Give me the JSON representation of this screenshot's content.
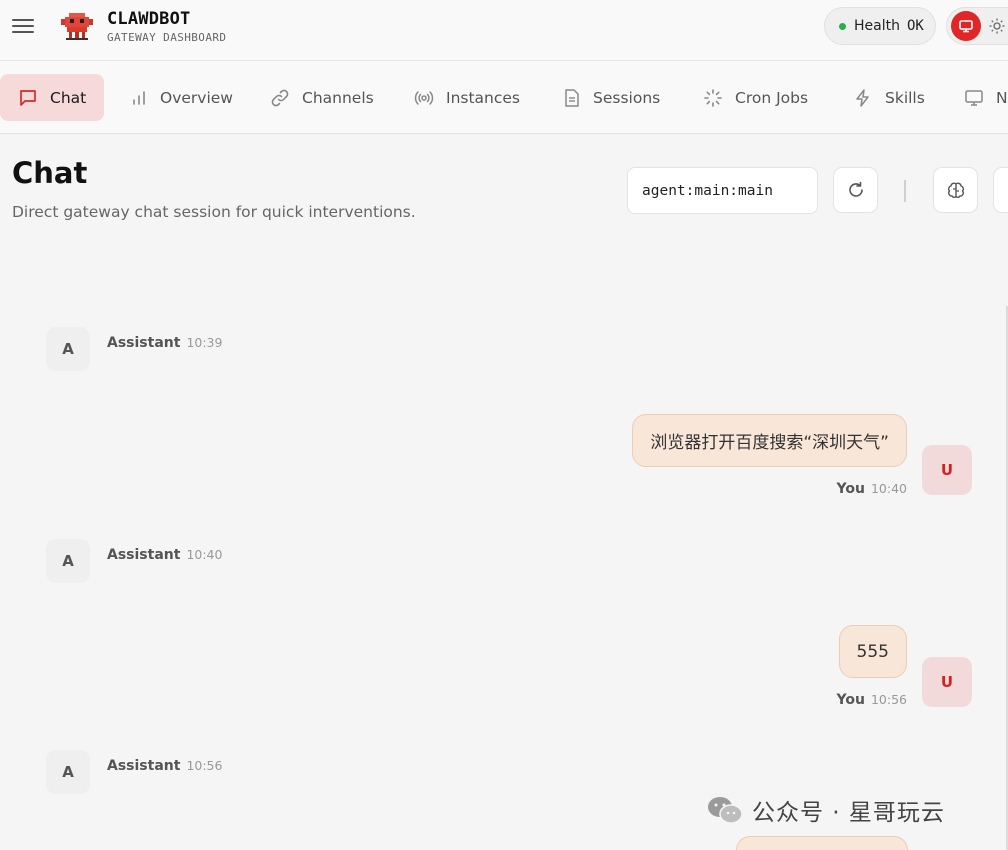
{
  "app": {
    "name": "CLAWDBOT",
    "subtitle": "GATEWAY DASHBOARD"
  },
  "status": {
    "health_label": "Health",
    "health_value": "OK"
  },
  "tabs": [
    {
      "label": "Chat",
      "icon": "message-square-icon",
      "active": true
    },
    {
      "label": "Overview",
      "icon": "bar-chart-icon"
    },
    {
      "label": "Channels",
      "icon": "link-icon"
    },
    {
      "label": "Instances",
      "icon": "radio-broadcast-icon"
    },
    {
      "label": "Sessions",
      "icon": "file-text-icon"
    },
    {
      "label": "Cron Jobs",
      "icon": "loader-icon"
    },
    {
      "label": "Skills",
      "icon": "zap-icon"
    },
    {
      "label": "N",
      "icon": "monitor-icon"
    }
  ],
  "page": {
    "title": "Chat",
    "description": "Direct gateway chat session for quick interventions."
  },
  "session": {
    "value": "agent:main:main"
  },
  "messages": [
    {
      "role": "assistant",
      "avatar": "A",
      "author": "Assistant",
      "time": "10:39"
    },
    {
      "role": "user",
      "avatar": "U",
      "author": "You",
      "time": "10:40",
      "text": "浏览器打开百度搜索“深圳天气”"
    },
    {
      "role": "assistant",
      "avatar": "A",
      "author": "Assistant",
      "time": "10:40"
    },
    {
      "role": "user",
      "avatar": "U",
      "author": "You",
      "time": "10:56",
      "text": "555"
    },
    {
      "role": "assistant",
      "avatar": "A",
      "author": "Assistant",
      "time": "10:56"
    }
  ],
  "watermark": {
    "text": "公众号 · 星哥玩云"
  },
  "colors": {
    "accent": "#e02626",
    "active_tab_bg": "#f6d9d9",
    "user_bubble_bg": "#f8e6d8",
    "health_ok": "#22b14c"
  }
}
